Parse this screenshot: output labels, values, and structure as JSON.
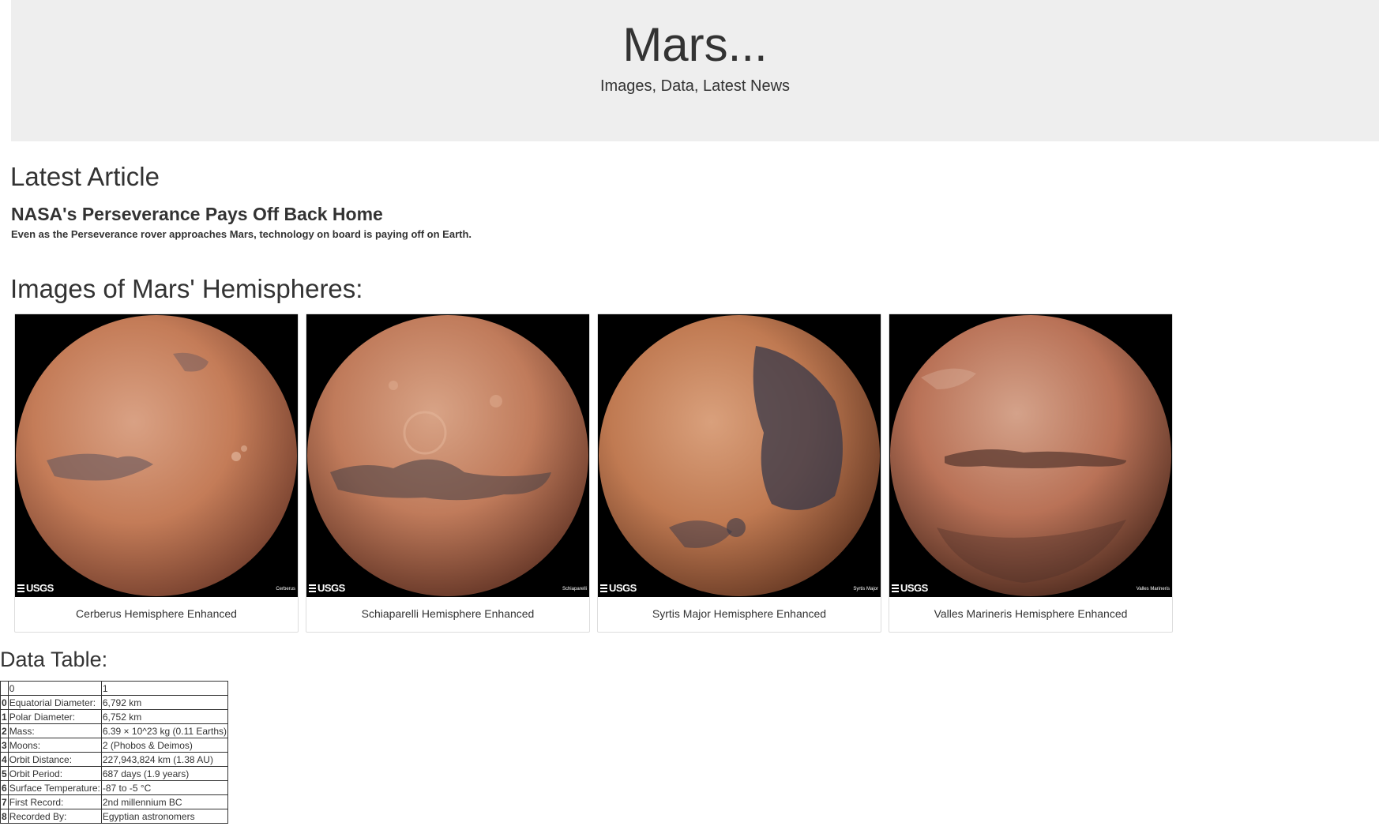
{
  "header": {
    "title": "Mars...",
    "subtitle": "Images, Data, Latest News"
  },
  "latest_article": {
    "heading": "Latest Article",
    "title": "NASA's Perseverance Pays Off Back Home",
    "teaser": "Even as the Perseverance rover approaches Mars, technology on board is paying off on Earth."
  },
  "hemispheres": {
    "heading": "Images of Mars' Hemispheres:",
    "items": [
      {
        "caption": "Cerberus Hemisphere Enhanced",
        "image_label": "Cerberus",
        "logo": "USGS"
      },
      {
        "caption": "Schiaparelli Hemisphere Enhanced",
        "image_label": "Schiaparelli",
        "logo": "USGS"
      },
      {
        "caption": "Syrtis Major Hemisphere Enhanced",
        "image_label": "Syrtis Major",
        "logo": "USGS"
      },
      {
        "caption": "Valles Marineris Hemisphere Enhanced",
        "image_label": "Valles Marineris",
        "logo": "USGS"
      }
    ]
  },
  "data_table": {
    "heading": "Data Table:",
    "columns": [
      "",
      "0",
      "1"
    ],
    "rows": [
      [
        "0",
        "Equatorial Diameter:",
        "6,792 km"
      ],
      [
        "1",
        "Polar Diameter:",
        "6,752 km"
      ],
      [
        "2",
        "Mass:",
        "6.39 × 10^23 kg (0.11 Earths)"
      ],
      [
        "3",
        "Moons:",
        "2 (Phobos & Deimos)"
      ],
      [
        "4",
        "Orbit Distance:",
        "227,943,824 km (1.38 AU)"
      ],
      [
        "5",
        "Orbit Period:",
        "687 days (1.9 years)"
      ],
      [
        "6",
        "Surface Temperature:",
        "-87 to -5 °C"
      ],
      [
        "7",
        "First Record:",
        "2nd millennium BC"
      ],
      [
        "8",
        "Recorded By:",
        "Egyptian astronomers"
      ]
    ]
  },
  "colors": {
    "jumbotron_bg": "#eeeeee",
    "text": "#333333",
    "mars_surface": "#c9825f",
    "mars_dark": "#5a4a48"
  }
}
